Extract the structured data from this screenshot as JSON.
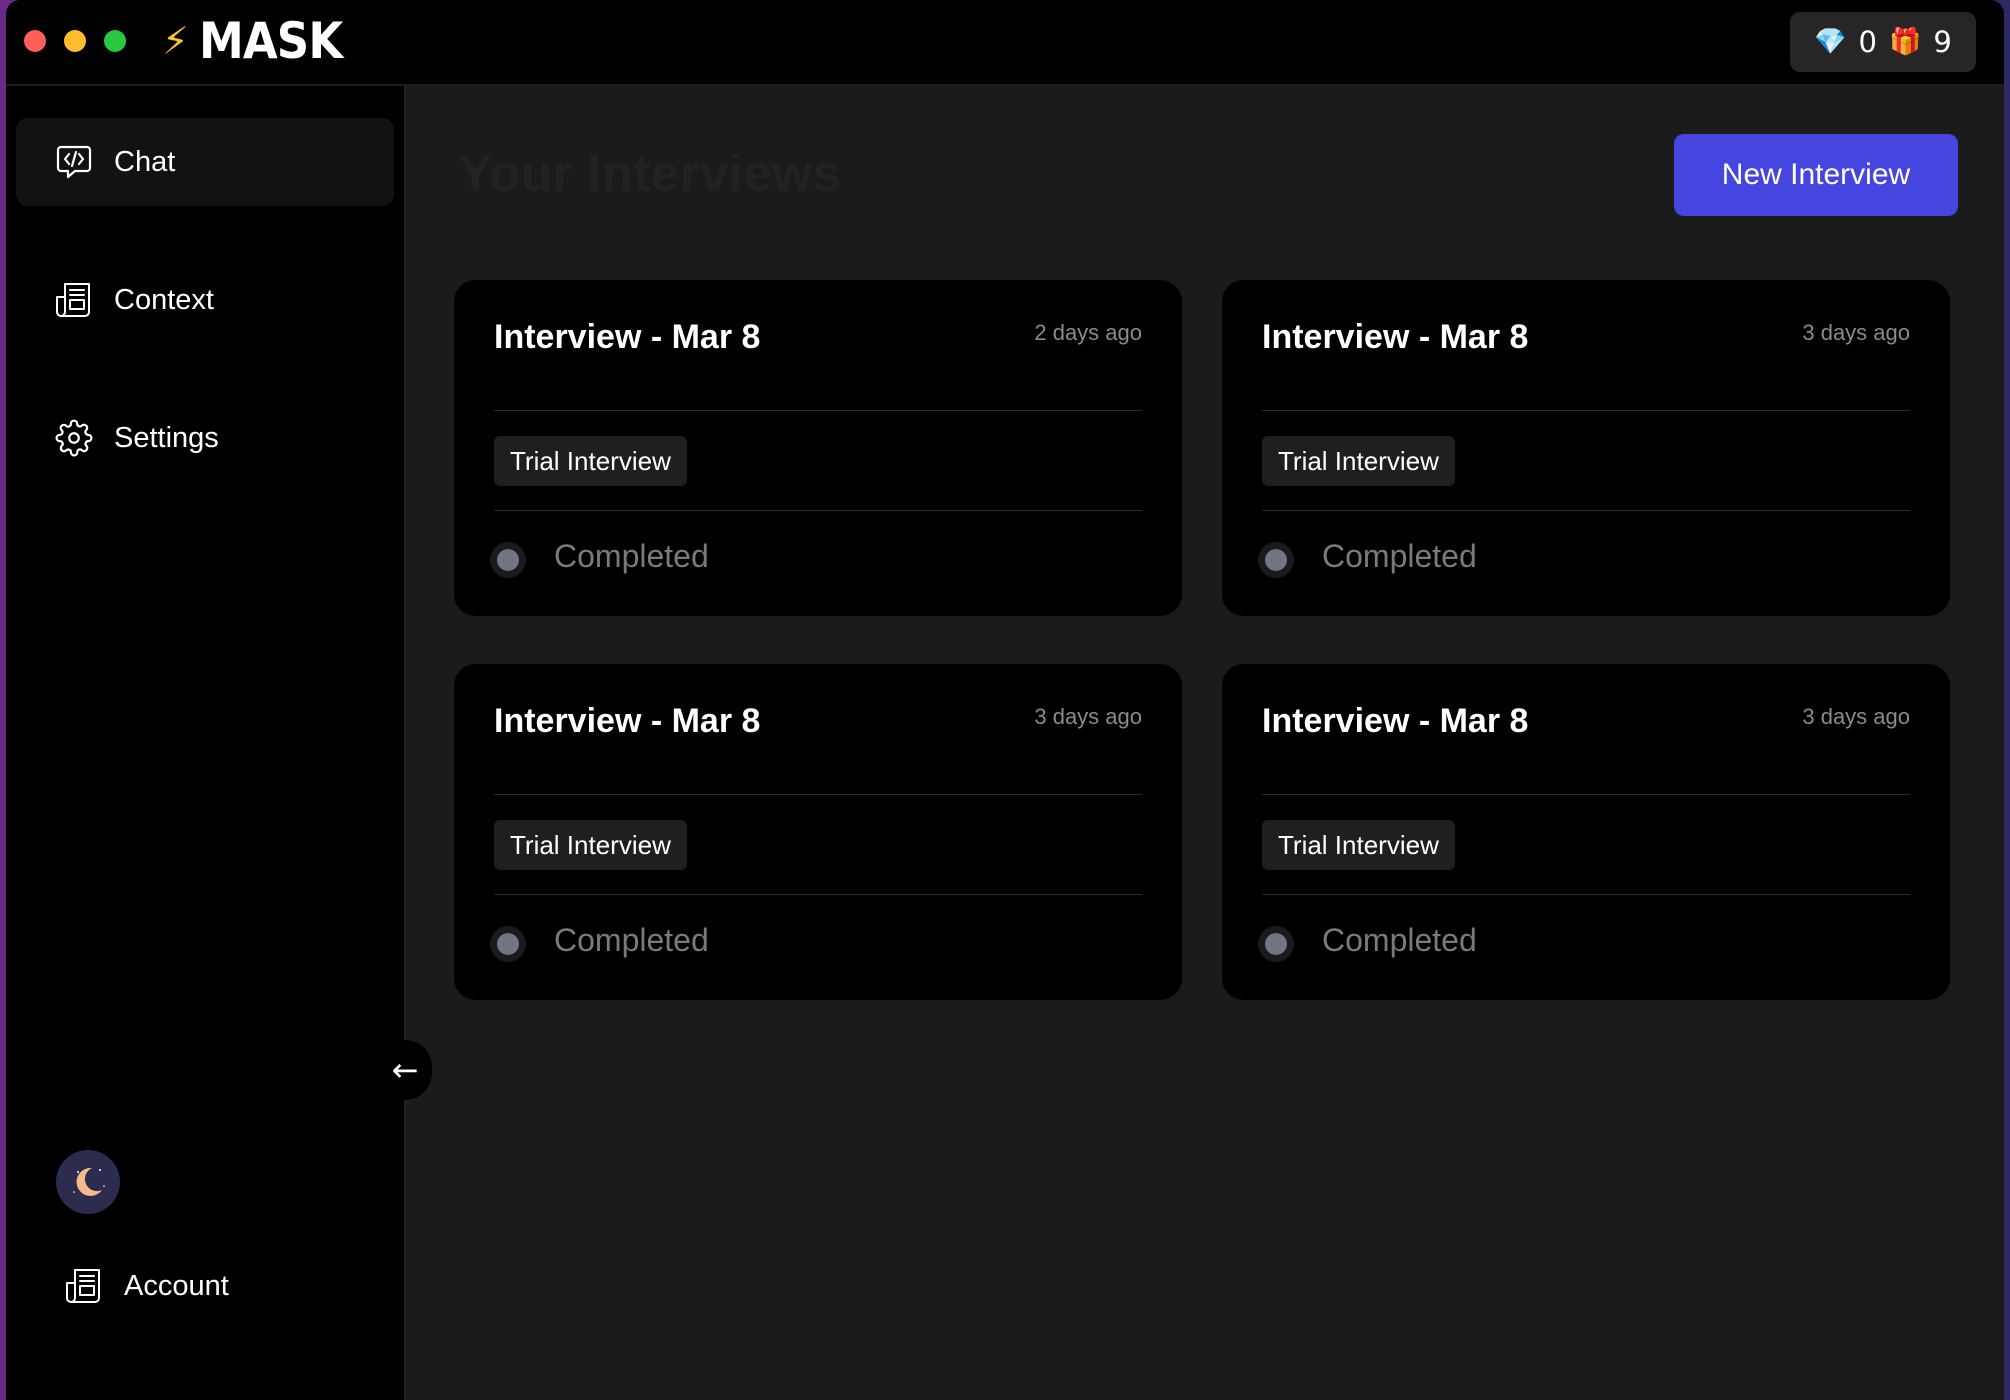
{
  "app": {
    "name": "MASK"
  },
  "credits": {
    "gems": "0",
    "gifts": "9"
  },
  "sidebar": {
    "items": [
      {
        "label": "Chat",
        "icon": "chat-code-icon",
        "active": true
      },
      {
        "label": "Context",
        "icon": "document-icon",
        "active": false
      },
      {
        "label": "Settings",
        "icon": "gear-icon",
        "active": false
      }
    ],
    "account_label": "Account",
    "collapse_glyph": "←"
  },
  "main": {
    "title": "Your Interviews",
    "new_button": "New Interview",
    "cards": [
      {
        "title": "Interview - Mar 8",
        "time": "2 days ago",
        "tag": "Trial Interview",
        "status": "Completed"
      },
      {
        "title": "Interview - Mar 8",
        "time": "3 days ago",
        "tag": "Trial Interview",
        "status": "Completed"
      },
      {
        "title": "Interview - Mar 8",
        "time": "3 days ago",
        "tag": "Trial Interview",
        "status": "Completed"
      },
      {
        "title": "Interview - Mar 8",
        "time": "3 days ago",
        "tag": "Trial Interview",
        "status": "Completed"
      }
    ]
  },
  "colors": {
    "accent": "#4545e0",
    "background": "#1b1b1b",
    "card": "#000000",
    "status_dot": "#6f7585"
  }
}
